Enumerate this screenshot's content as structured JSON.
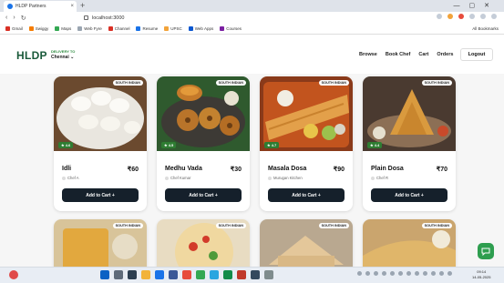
{
  "browser": {
    "tab_title": "HLDP Partners",
    "new_tab": "+",
    "url": "localhost:3000",
    "bookmarks": [
      "Gmail",
      "Swiggy",
      "Maps",
      "Web Fyre",
      "Channel",
      "Resume",
      "UPSC",
      "Web Apps",
      "Courses"
    ],
    "all_bookmarks": "All Bookmarks"
  },
  "nav": {
    "logo": "HLDP",
    "deliver_label": "DELIVERY TO",
    "city": "Chennai ⌄",
    "links": [
      "Browse",
      "Book Chef",
      "Cart",
      "Orders"
    ],
    "logout": "Logout"
  },
  "dishes": [
    {
      "tag": "SOUTH INDIAN",
      "rating": "★ 4.6",
      "name": "Idli",
      "price": "₹60",
      "chef": "Chef A",
      "button": "Add to Cart +"
    },
    {
      "tag": "SOUTH INDIAN",
      "rating": "★ 4.5",
      "name": "Medhu Vada",
      "price": "₹30",
      "chef": "Chef Kumar",
      "button": "Add to Cart +"
    },
    {
      "tag": "SOUTH INDIAN",
      "rating": "★ 4.7",
      "name": "Masala Dosa",
      "price": "₹90",
      "chef": "Murugan Kitchen",
      "button": "Add to Cart +"
    },
    {
      "tag": "SOUTH INDIAN",
      "rating": "★ 4.4",
      "name": "Plain Dosa",
      "price": "₹70",
      "chef": "Chef R",
      "button": "Add to Cart +"
    }
  ],
  "dishes_row2": [
    {
      "tag": "SOUTH INDIAN"
    },
    {
      "tag": "SOUTH INDIAN"
    },
    {
      "tag": "SOUTH INDIAN"
    },
    {
      "tag": "SOUTH INDIAN"
    }
  ],
  "taskbar": {
    "time": "09:14",
    "date": "14-05-2025"
  },
  "colors": {
    "brand": "#1a5a3a",
    "button": "#15202b",
    "rating": "#2e7d32",
    "fab": "#2e9e4f"
  }
}
